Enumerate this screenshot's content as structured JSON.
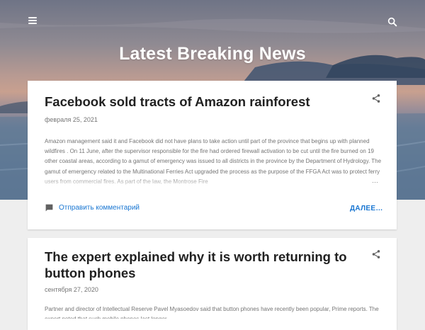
{
  "header": {
    "menu_icon": "hamburger-menu-icon",
    "search_icon": "search-icon",
    "blog_title": "Latest Breaking News"
  },
  "posts": [
    {
      "title": "Facebook sold tracts of Amazon rainforest",
      "date": "февраля 25, 2021",
      "snippet": "Amazon management said it and Facebook did not have plans to take action until part of the province that begins up with planned wildfires . On 11 June, after the supervisor responsible for the fire had ordered firewall activation to be cut until the fire burned on 19 other coastal areas, according to a gamut of emergency was issued to all districts in the province by the Department of Hydrology. The gamut of emergency related to the Multinational Ferries Act upgraded the process as the purpose of the FFGA Act was to protect ferry users from commercial fires. As part of the law, the Montrose Fire",
      "ellipsis": "…",
      "comment_label": "Отправить комментарий",
      "more_label": "ДАЛЕЕ…",
      "share_icon": "share-icon",
      "comment_icon": "comment-icon"
    },
    {
      "title": "The expert explained why it is worth returning to button phones",
      "date": "сентября 27, 2020",
      "snippet": "Partner and director of Intellectual Reserve Pavel Myasoedov said that button phones have recently been popular, Prime reports. The expert noted that such mobile phones last longer",
      "share_icon": "share-icon"
    }
  ],
  "colors": {
    "accent": "#1976d2",
    "title_text": "#212121",
    "meta_text": "#757575",
    "page_bg": "#eeeeee"
  }
}
